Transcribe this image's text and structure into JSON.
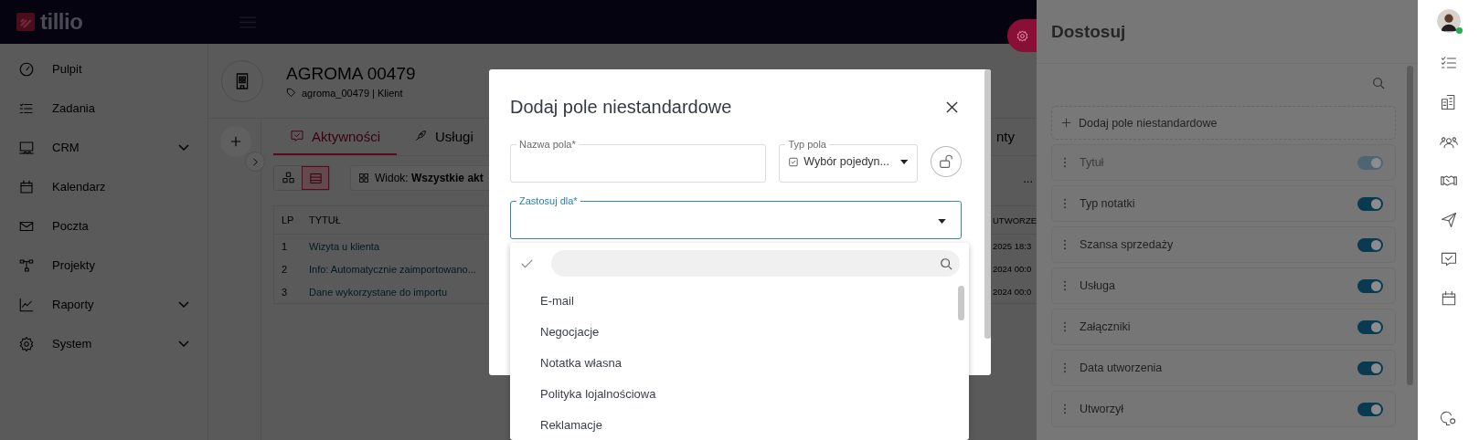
{
  "app": {
    "logo": "tillio"
  },
  "sidebar": {
    "items": [
      {
        "label": "Pulpit",
        "expandable": false
      },
      {
        "label": "Zadania",
        "expandable": false
      },
      {
        "label": "CRM",
        "expandable": true
      },
      {
        "label": "Kalendarz",
        "expandable": false
      },
      {
        "label": "Poczta",
        "expandable": false
      },
      {
        "label": "Projekty",
        "expandable": false
      },
      {
        "label": "Raporty",
        "expandable": true
      },
      {
        "label": "System",
        "expandable": true
      }
    ]
  },
  "record": {
    "title": "AGROMA 00479",
    "subtitle": "agroma_00479 | Klient"
  },
  "tabs": [
    {
      "label": "Aktywności",
      "selected": true
    },
    {
      "label": "Usługi",
      "selected": false
    },
    {
      "label": "nty",
      "selected": false
    }
  ],
  "toolbar": {
    "view_modes": [
      {
        "selected": false
      },
      {
        "selected": true
      }
    ],
    "view": "Widok: **Wszystkie akt**",
    "more": "..."
  },
  "table": {
    "columns": [
      "LP",
      "TYTUŁ",
      "UTWORZE"
    ],
    "rows": [
      {
        "lp": "1",
        "title": "Wizyta u klienta",
        "created": "2025 18:3"
      },
      {
        "lp": "2",
        "title": "Info: Automatycznie zaimportowano...",
        "created": "2024 00:0"
      },
      {
        "lp": "3",
        "title": "Dane wykorzystane do importu",
        "created": "2024 00:0"
      }
    ]
  },
  "modal": {
    "title": "Dodaj pole niestandardowe",
    "name_field": {
      "label": "Nazwa pola*"
    },
    "type_field": {
      "label": "Typ pola",
      "value": "Wybór pojedyn..."
    },
    "apply_field": {
      "label": "Zastosuj dla*",
      "focused": true
    },
    "options": [
      "E-mail",
      "Negocjacje",
      "Notatka własna",
      "Polityka lojalnościowa",
      "Reklamacje"
    ]
  },
  "panel": {
    "title": "Dostosuj",
    "add_label": "Dodaj pole niestandardowe",
    "fields": [
      {
        "label": "Tytuł",
        "on": true,
        "disabled": true
      },
      {
        "label": "Typ notatki",
        "on": true,
        "disabled": false
      },
      {
        "label": "Szansa sprzedaży",
        "on": true,
        "disabled": false
      },
      {
        "label": "Usługa",
        "on": true,
        "disabled": false
      },
      {
        "label": "Załączniki",
        "on": true,
        "disabled": false
      },
      {
        "label": "Data utworzenia",
        "on": true,
        "disabled": false
      },
      {
        "label": "Utworzył",
        "on": true,
        "disabled": false
      }
    ]
  },
  "user": {
    "online": true
  }
}
